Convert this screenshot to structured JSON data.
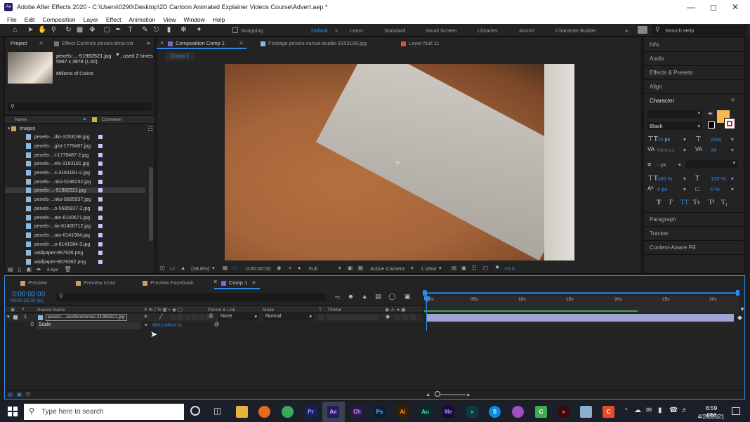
{
  "window": {
    "title": "Adobe After Effects 2020 - C:\\Users\\0290\\Desktop\\2D Cartoon Animated Explainer Videos Course\\Advert.aep *"
  },
  "menu": [
    "File",
    "Edit",
    "Composition",
    "Layer",
    "Effect",
    "Animation",
    "View",
    "Window",
    "Help"
  ],
  "toolbar": {
    "snapping": "Snapping",
    "workspaces": [
      "Default",
      "Learn",
      "Standard",
      "Small Screen",
      "Libraries",
      "AtomX",
      "Character Builder"
    ],
    "search_help": "Search Help"
  },
  "project": {
    "tab": "Project",
    "effect_controls": "Effect Controls pexels-tima-mir",
    "selected_name": "pexels-...-51982521.jpg",
    "used": ", used 2 times",
    "dims": "5967 x 3978 (1.00)",
    "colors": "Millions of Colors",
    "col_name": "Name",
    "col_comment": "Comment",
    "folder": "Images",
    "items": [
      "pexels-...dio-3153198.jpg",
      "pexels-...gist-1779487.jpg",
      "pexels-...t-1779487-2.jpg",
      "pexels-...els-3183181.jpg",
      "pexels-...s-3183181-2.jpg",
      "pexels-...nko-5198252.jpg",
      "pexels-...-51982521.jpg",
      "pexels-...nko-5685937.jpg",
      "pexels-...o-5685937-2.jpg",
      "pexels-...ato-6140671.jpg",
      "pexels-...tio-61406712.jpg",
      "pexels-...ato-6141084.jpg",
      "pexels-...o-6141084-3.jpg",
      "wallpaper-967836.png",
      "wallpaper-9678362.png"
    ],
    "bpc": "8 bpc"
  },
  "viewer": {
    "tabs": [
      "Composition Comp 1",
      "Footage pexels-canva-studio-3153198.jpg",
      "Layer Null 11"
    ],
    "subtab": "Comp 1",
    "zoom": "(38.8%)",
    "timecode": "0:00:00:00",
    "resolution": "Full",
    "camera": "Active Camera",
    "view": "1 View",
    "exposure": "+0.0"
  },
  "right": {
    "info": "Info",
    "audio": "Audio",
    "effects": "Effects & Presets",
    "align": "Align",
    "character": "Character",
    "font_style": "Black",
    "font_size": "74",
    "font_size_unit": "px",
    "leading": "Auto",
    "kerning": "Metrics",
    "tracking": "34",
    "stroke": "- px",
    "v_scale": "100 %",
    "h_scale": "100 %",
    "baseline": "0 px",
    "tsume": "0 %",
    "paragraph": "Paragraph",
    "tracker": "Tracker",
    "fill": "Content-Aware Fill"
  },
  "timeline": {
    "tabs": [
      "Preview",
      "Preview Insta",
      "Preview Facebook",
      "Comp 1"
    ],
    "timecode": "0:00:00:00",
    "fps": "00000 (29.00 fps)",
    "cols": {
      "source": "Source Name",
      "parent": "Parent & Link",
      "mode": "Mode",
      "t": "T",
      "trkmat": "TrkMat"
    },
    "layer_num": "1",
    "layer_name": "pexels-...ieoshnichenko-51982521.jpg",
    "parent": "None",
    "mode": "Normal",
    "prop": "Scale",
    "scale_val": "669.0,669.0 %",
    "ruler": [
      "00s",
      "05s",
      "10s",
      "15s",
      "20s",
      "25s",
      "30s"
    ]
  },
  "taskbar": {
    "search": "Type here to search",
    "time": "8:59 PM",
    "date": "4/28/2021"
  },
  "colors": {
    "accent": "#2d8ceb",
    "swatch": "#f9b94a"
  }
}
